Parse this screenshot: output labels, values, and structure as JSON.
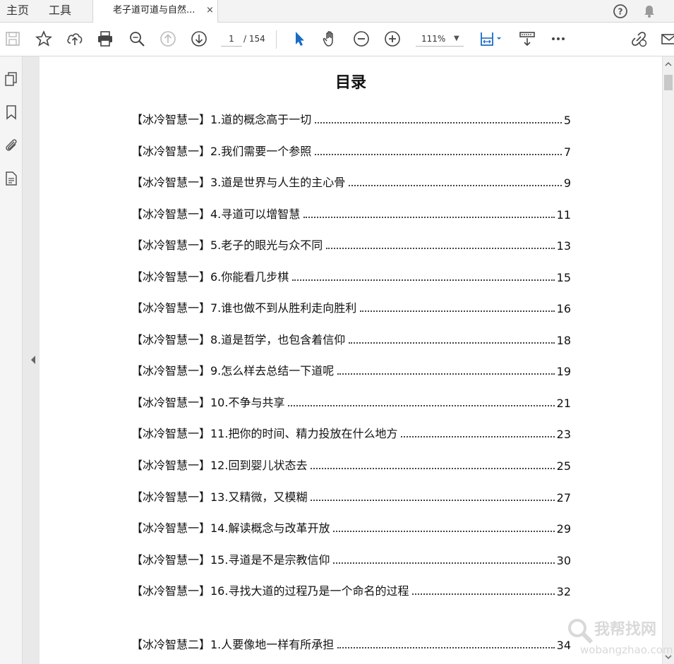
{
  "tabs": {
    "home": "主页",
    "tools": "工具",
    "doc_title": "老子道可道与自然...",
    "close": "×"
  },
  "toolbar": {
    "page_current": "1",
    "page_total": "/ 154",
    "zoom": "111%"
  },
  "icons": [
    "save-icon",
    "star-icon",
    "upload-icon",
    "print-icon",
    "zoom-search-icon",
    "prev-page-icon",
    "next-page-icon",
    "select-arrow-icon",
    "hand-icon",
    "zoom-out-icon",
    "zoom-in-icon",
    "fit-page-icon",
    "scroll-mode-icon",
    "more-icon",
    "share-link-icon",
    "mail-icon",
    "help-icon",
    "bell-icon",
    "pages-icon",
    "bookmark-icon",
    "attachment-icon",
    "document-icon"
  ],
  "toc": {
    "title": "目录",
    "entries": [
      {
        "text": "【冰冷智慧一】1.道的概念高于一切",
        "page": "5"
      },
      {
        "text": "【冰冷智慧一】2.我们需要一个参照",
        "page": "7"
      },
      {
        "text": "【冰冷智慧一】3.道是世界与人生的主心骨",
        "page": "9"
      },
      {
        "text": "【冰冷智慧一】4.寻道可以增智慧",
        "page": "11"
      },
      {
        "text": "【冰冷智慧一】5.老子的眼光与众不同",
        "page": "13"
      },
      {
        "text": "【冰冷智慧一】6.你能看几步棋",
        "page": "15"
      },
      {
        "text": "【冰冷智慧一】7.谁也做不到从胜利走向胜利",
        "page": "16"
      },
      {
        "text": "【冰冷智慧一】8.道是哲学，也包含着信仰",
        "page": "18"
      },
      {
        "text": "【冰冷智慧一】9.怎么样去总结一下道呢",
        "page": "19"
      },
      {
        "text": "【冰冷智慧一】10.不争与共享",
        "page": "21"
      },
      {
        "text": "【冰冷智慧一】11.把你的时间、精力投放在什么地方",
        "page": "23"
      },
      {
        "text": "【冰冷智慧一】12.回到婴儿状态去",
        "page": "25"
      },
      {
        "text": "【冰冷智慧一】13.又精微，又模糊",
        "page": "27"
      },
      {
        "text": "【冰冷智慧一】14.解读概念与改革开放",
        "page": "29"
      },
      {
        "text": "【冰冷智慧一】15.寻道是不是宗教信仰",
        "page": "30"
      },
      {
        "text": "【冰冷智慧一】16.寻找大道的过程乃是一个命名的过程",
        "page": "32"
      },
      {
        "text": "【冰冷智慧二】1.人要像地一样有所承担",
        "page": "34"
      }
    ]
  },
  "watermark": {
    "cn": "我帮找网",
    "en": "wobangzhao.com"
  }
}
